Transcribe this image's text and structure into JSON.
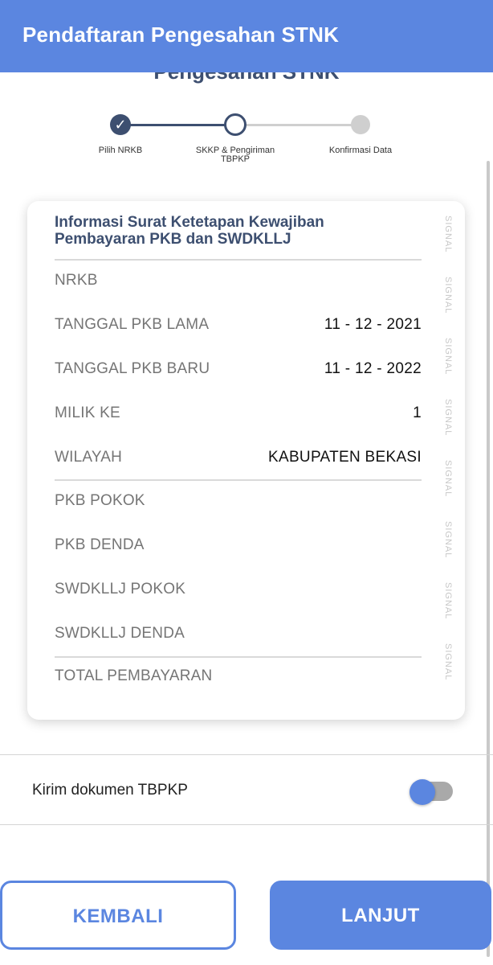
{
  "header": {
    "title": "Pendaftaran Pengesahan STNK",
    "behind_title": "Pengesahan STNK",
    "accent_color": "#5b86e0"
  },
  "stepper": {
    "steps": [
      {
        "label": "Pilih NRKB",
        "state": "done"
      },
      {
        "label": "SKKP & Pengiriman TBPKP",
        "state": "active"
      },
      {
        "label": "Konfirmasi Data",
        "state": "pending"
      }
    ],
    "check_icon": "check-icon"
  },
  "card": {
    "title": "Informasi Surat Ketetapan Kewajiban Pembayaran PKB dan SWDKLLJ",
    "watermark_text": "SIGNAL",
    "rows": [
      {
        "label": "NRKB",
        "value": ""
      },
      {
        "label": "TANGGAL PKB LAMA",
        "value": "11 - 12 - 2021"
      },
      {
        "label": "TANGGAL PKB BARU",
        "value": "11 - 12 - 2022"
      },
      {
        "label": "MILIK KE",
        "value": "1"
      },
      {
        "label": "WILAYAH",
        "value": "KABUPATEN BEKASI"
      },
      {
        "label": "PKB POKOK",
        "value": ""
      },
      {
        "label": "PKB DENDA",
        "value": ""
      },
      {
        "label": "SWDKLLJ POKOK",
        "value": ""
      },
      {
        "label": "SWDKLLJ DENDA",
        "value": ""
      },
      {
        "label": "TOTAL PEMBAYARAN",
        "value": ""
      }
    ]
  },
  "toggle": {
    "label": "Kirim dokumen TBPKP",
    "checked": false
  },
  "buttons": {
    "back_label": "KEMBALI",
    "next_label": "LANJUT"
  }
}
